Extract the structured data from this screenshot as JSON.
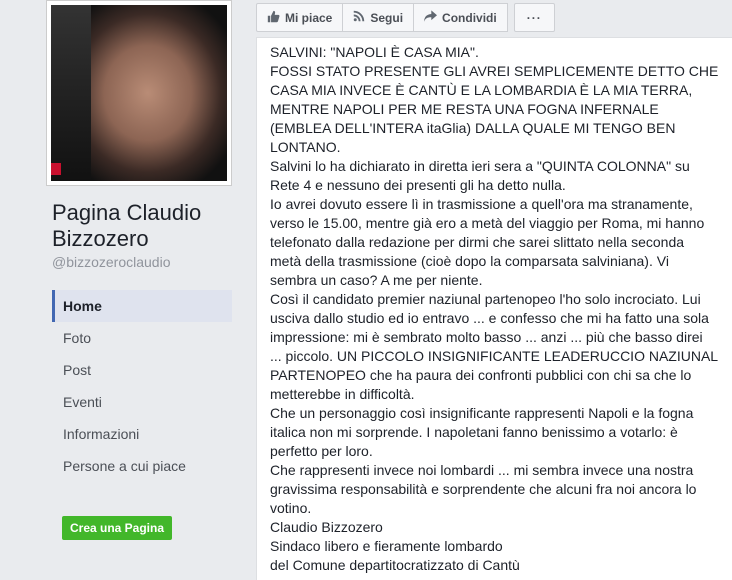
{
  "page": {
    "name": "Pagina Claudio Bizzozero",
    "handle": "@bizzozeroclaudio"
  },
  "nav": {
    "items": [
      {
        "label": "Home",
        "active": true
      },
      {
        "label": "Foto"
      },
      {
        "label": "Post"
      },
      {
        "label": "Eventi"
      },
      {
        "label": "Informazioni"
      },
      {
        "label": "Persone a cui piace"
      }
    ]
  },
  "create_page_label": "Crea una Pagina",
  "actions": {
    "like": {
      "label": "Mi piace",
      "icon": "thumbs-up-icon"
    },
    "follow": {
      "label": "Segui",
      "icon": "rss-icon"
    },
    "share": {
      "label": "Condividi",
      "icon": "share-arrow-icon"
    },
    "more": {
      "label": "···",
      "icon": "more-dots-icon"
    }
  },
  "post": {
    "text": "SALVINI: \"NAPOLI È CASA MIA\".\nFOSSI STATO PRESENTE GLI AVREI SEMPLICEMENTE DETTO CHE\nCASA MIA INVECE È CANTÙ E LA LOMBARDIA È LA MIA TERRA,\nMENTRE NAPOLI PER ME RESTA UNA FOGNA INFERNALE\n(EMBLEA DELL'INTERA itaGlia) DALLA QUALE MI TENGO BEN\nLONTANO.\nSalvini lo ha dichiarato in diretta ieri sera a \"QUINTA COLONNA\" su\nRete 4 e nessuno dei presenti gli ha detto nulla.\nIo avrei dovuto essere lì in trasmissione a quell'ora ma stranamente,\nverso le 15.00, mentre già ero a metà del viaggio per Roma, mi hanno\ntelefonato dalla redazione per dirmi che sarei slittato nella seconda\nmetà della trasmissione (cioè dopo la comparsata salviniana). Vi\nsembra un caso? A me per niente.\nCosì il candidato premier naziunal partenopeo l'ho solo incrociato. Lui\nusciva dallo studio ed io entravo ... e confesso che mi ha fatto una sola\nimpressione: mi è sembrato molto basso ... anzi ... più che basso direi\n... piccolo. UN PICCOLO INSIGNIFICANTE LEADERUCCIO NAZIUNAL\nPARTENOPEO che ha paura dei confronti pubblici con chi sa che lo\nmetterebbe in difficoltà.\nChe un personaggio così insignificante rappresenti Napoli e la fogna\nitalica non mi sorprende. I napoletani fanno benissimo a votarlo: è\nperfetto per loro.\nChe rappresenti invece noi lombardi ... mi sembra invece una nostra\ngravissima responsabilità e sorprendente che alcuni fra noi ancora lo\nvotino.\nClaudio Bizzozero\nSindaco libero e fieramente lombardo\ndel Comune departitocratizzato di Cantù"
  }
}
